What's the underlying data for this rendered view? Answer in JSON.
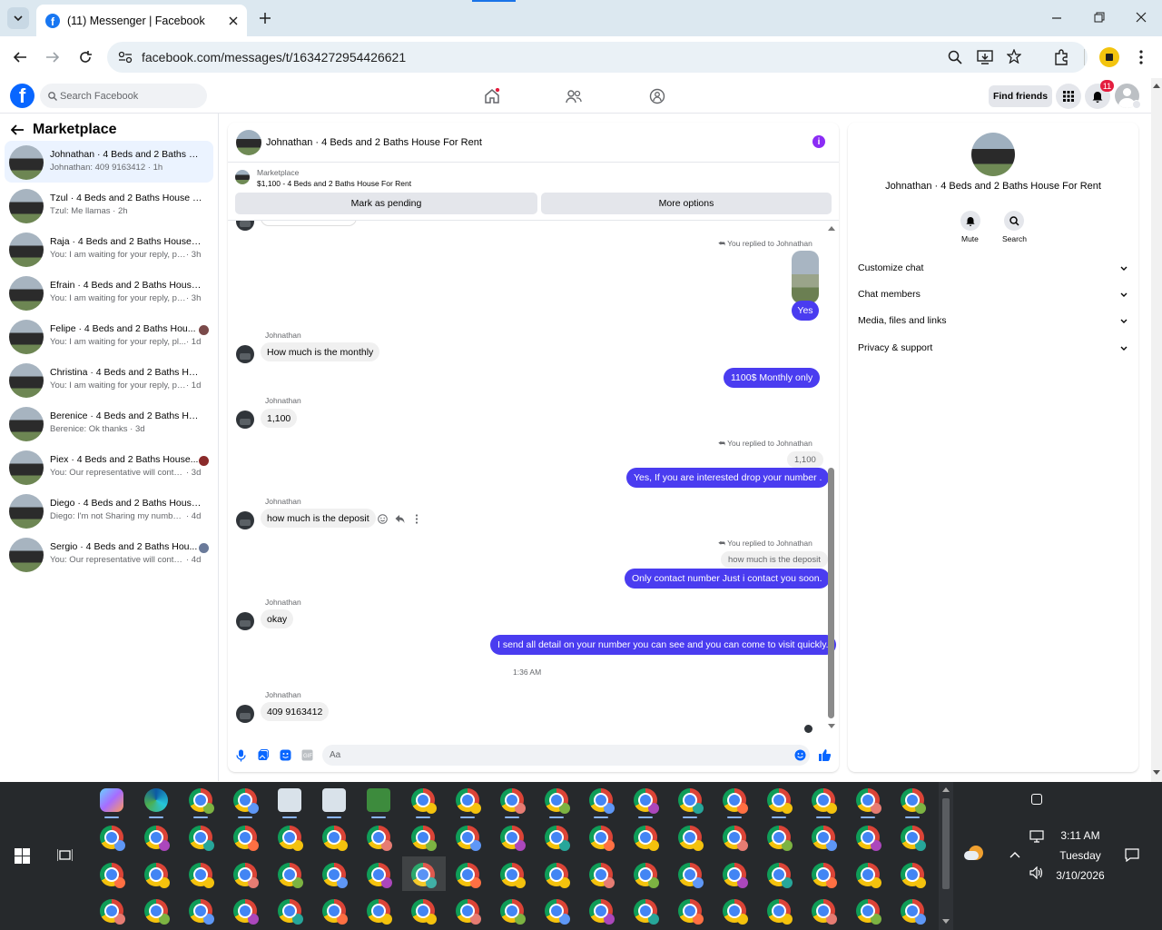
{
  "browser": {
    "tab_title": "(11) Messenger | Facebook",
    "url": "facebook.com/messages/t/1634272954426621"
  },
  "fb": {
    "search_placeholder": "Search Facebook",
    "find_friends": "Find friends",
    "notification_count": "11"
  },
  "left": {
    "back_title": "Marketplace",
    "conversations": [
      {
        "name": "Johnathan · 4 Beds and 2 Baths H...",
        "snippet": "Johnathan: 409 9163412 · 1h",
        "time": ""
      },
      {
        "name": "Tzul · 4 Beds and 2 Baths House F...",
        "snippet": "Tzul: Me llamas · 2h",
        "time": ""
      },
      {
        "name": "Raja · 4 Beds and 2 Baths House F...",
        "snippet": "You: I am waiting for your reply, pleas...",
        "time": "· 3h"
      },
      {
        "name": "Efrain · 4 Beds and 2 Baths House ...",
        "snippet": "You: I am waiting for your reply, pleas...",
        "time": "· 3h"
      },
      {
        "name": "Felipe · 4 Beds and 2 Baths Hou...",
        "snippet": "You: I am waiting for your reply, pl...",
        "time": "· 1d"
      },
      {
        "name": "Christina · 4 Beds and 2 Baths Hou...",
        "snippet": "You: I am waiting for your reply, pleas...",
        "time": "· 1d"
      },
      {
        "name": "Berenice · 4 Beds and 2 Baths Hou...",
        "snippet": "Berenice: Ok thanks · 3d",
        "time": ""
      },
      {
        "name": "Piex · 4 Beds and 2 Baths House...",
        "snippet": "You: Our representative will contac...",
        "time": "· 3d"
      },
      {
        "name": "Diego · 4 Beds and 2 Baths House ...",
        "snippet": "Diego: I'm not Sharing my number wi...",
        "time": "· 4d"
      },
      {
        "name": "Sergio · 4 Beds and 2 Baths Hou...",
        "snippet": "You: Our representative will contac...",
        "time": "· 4d"
      }
    ]
  },
  "chat": {
    "header_title": "Johnathan · 4 Beds and 2 Baths House For Rent",
    "listing_label": "Marketplace",
    "listing_title": "$1,100 - 4 Beds and 2 Baths House For Rent",
    "mark_pending": "Mark as pending",
    "more_options": "More options",
    "sender_name": "Johnathan",
    "replied_label": "You replied to Johnathan",
    "msg_yes": "Yes",
    "msg_monthly_q": "How much is the monthly",
    "msg_monthly_a": "1100$ Monthly only",
    "msg_1100": "1,100",
    "quote_1100": "1,100",
    "msg_interested": "Yes, If you are interested drop your number .",
    "msg_deposit_q": "how much is the deposit",
    "quote_deposit": "how much is the deposit",
    "msg_contact": "Only contact number Just i contact you soon.",
    "msg_okay": "okay",
    "msg_detail": "I send all detail on your number you can see and you can come to visit quickly.",
    "timestamp": "1:36 AM",
    "msg_phone": "409 9163412",
    "composer_placeholder": "Aa"
  },
  "right": {
    "name": "Johnathan · 4 Beds and 2 Baths House For Rent",
    "mute": "Mute",
    "search": "Search",
    "items": [
      "Customize chat",
      "Chat members",
      "Media, files and links",
      "Privacy & support"
    ]
  },
  "taskbar": {
    "time": "3:11 AM",
    "day": "Tuesday",
    "date": "3/10/2026"
  }
}
